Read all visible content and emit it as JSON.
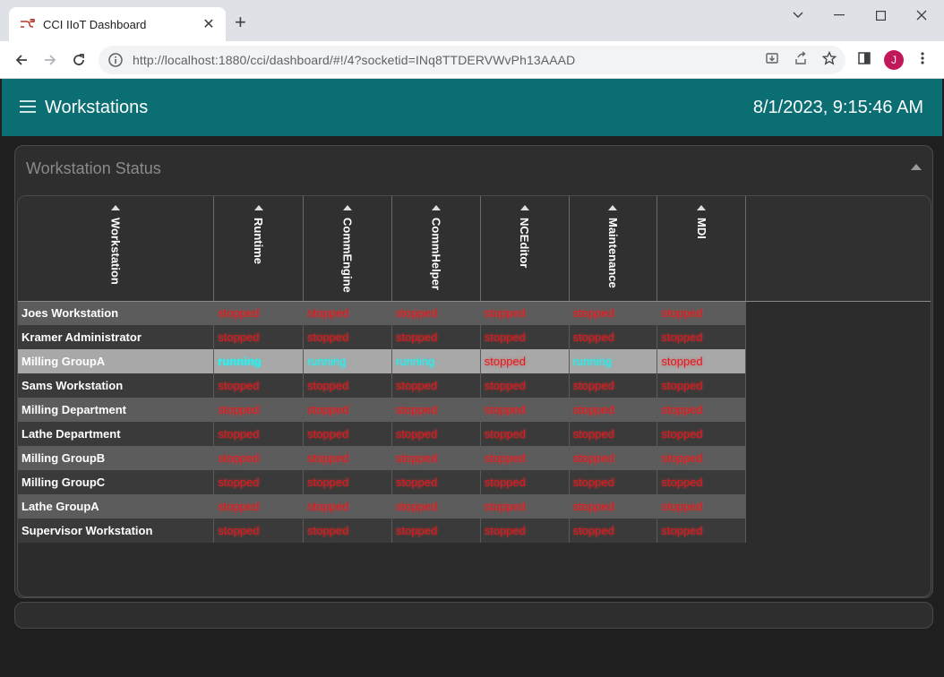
{
  "browser": {
    "tab_title": "CCI IIoT Dashboard",
    "url": "http://localhost:1880/cci/dashboard/#!/4?socketid=INq8TTDERVWvPh13AAAD",
    "profile_initial": "J"
  },
  "app": {
    "title": "Workstations",
    "clock": "8/1/2023, 9:15:46 AM",
    "accent_color": "#0a6e73"
  },
  "group": {
    "title": "Workstation Status"
  },
  "table": {
    "columns": [
      "Workstation",
      "Runtime",
      "CommEngine",
      "CommHelper",
      "NCEditor",
      "Maintenance",
      "MDI"
    ],
    "rows": [
      {
        "name": "Joes Workstation",
        "status": [
          "stopped",
          "stopped",
          "stopped",
          "stopped",
          "stopped",
          "stopped"
        ]
      },
      {
        "name": "Kramer Administrator",
        "status": [
          "stopped",
          "stopped",
          "stopped",
          "stopped",
          "stopped",
          "stopped"
        ]
      },
      {
        "name": "Milling GroupA",
        "status": [
          "running",
          "running",
          "running",
          "stopped",
          "running",
          "stopped"
        ]
      },
      {
        "name": "Sams Workstation",
        "status": [
          "stopped",
          "stopped",
          "stopped",
          "stopped",
          "stopped",
          "stopped"
        ]
      },
      {
        "name": "Milling Department",
        "status": [
          "stopped",
          "stopped",
          "stopped",
          "stopped",
          "stopped",
          "stopped"
        ]
      },
      {
        "name": "Lathe Department",
        "status": [
          "stopped",
          "stopped",
          "stopped",
          "stopped",
          "stopped",
          "stopped"
        ]
      },
      {
        "name": "Milling GroupB",
        "status": [
          "stopped",
          "stopped",
          "stopped",
          "stopped",
          "stopped",
          "stopped"
        ]
      },
      {
        "name": "Milling GroupC",
        "status": [
          "stopped",
          "stopped",
          "stopped",
          "stopped",
          "stopped",
          "stopped"
        ]
      },
      {
        "name": "Lathe GroupA",
        "status": [
          "stopped",
          "stopped",
          "stopped",
          "stopped",
          "stopped",
          "stopped"
        ]
      },
      {
        "name": "Supervisor Workstation",
        "status": [
          "stopped",
          "stopped",
          "stopped",
          "stopped",
          "stopped",
          "stopped"
        ]
      }
    ],
    "status_colors": {
      "stopped": "#e0191e",
      "running": "#25f0f0"
    }
  }
}
